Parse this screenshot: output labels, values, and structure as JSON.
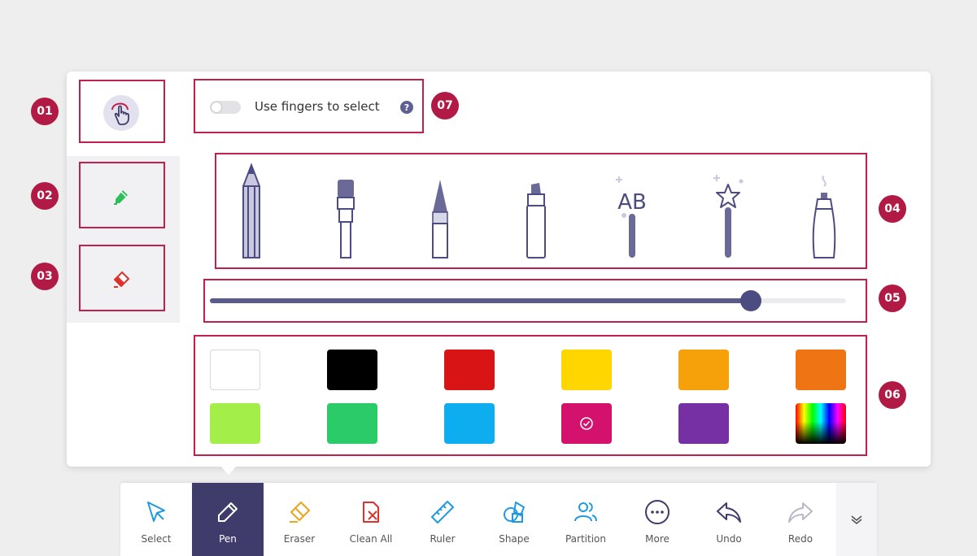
{
  "callouts": [
    "01",
    "02",
    "03",
    "04",
    "05",
    "06",
    "07"
  ],
  "finger_select": {
    "label": "Use fingers to select",
    "help_glyph": "?",
    "enabled": false
  },
  "modes": [
    {
      "icon": "finger-touch-icon",
      "selected": true
    },
    {
      "icon": "pen-mode-icon",
      "color": "#2fbf5a"
    },
    {
      "icon": "eraser-mode-icon",
      "color": "#e0302c"
    }
  ],
  "pen_types": [
    {
      "icon": "pencil-icon"
    },
    {
      "icon": "brush-icon"
    },
    {
      "icon": "fountain-tip-icon"
    },
    {
      "icon": "highlighter-icon"
    },
    {
      "icon": "text-recognition-pen-icon",
      "text": "AB"
    },
    {
      "icon": "magic-wand-icon"
    },
    {
      "icon": "spray-marker-icon"
    }
  ],
  "thickness": {
    "value_fraction": 0.85
  },
  "colors": [
    {
      "hex": "#ffffff"
    },
    {
      "hex": "#000000"
    },
    {
      "hex": "#d91414"
    },
    {
      "hex": "#ffd600"
    },
    {
      "hex": "#f6a10a"
    },
    {
      "hex": "#ee7414"
    },
    {
      "hex": "#a4ee4a"
    },
    {
      "hex": "#2ccb6a"
    },
    {
      "hex": "#0dadef"
    },
    {
      "hex": "#d4126e",
      "selected": true
    },
    {
      "hex": "#7630a3"
    },
    {
      "hex": "gradient",
      "icon": "color-spectrum-icon"
    }
  ],
  "toolbar": {
    "items": [
      {
        "label": "Select",
        "icon": "cursor-icon"
      },
      {
        "label": "Pen",
        "icon": "pen-icon",
        "active": true
      },
      {
        "label": "Eraser",
        "icon": "eraser-icon"
      },
      {
        "label": "Clean All",
        "icon": "clean-all-icon"
      },
      {
        "label": "Ruler",
        "icon": "ruler-icon"
      },
      {
        "label": "Shape",
        "icon": "shape-icon"
      },
      {
        "label": "Partition",
        "icon": "partition-icon"
      },
      {
        "label": "More",
        "icon": "more-icon"
      },
      {
        "label": "Undo",
        "icon": "undo-icon"
      },
      {
        "label": "Redo",
        "icon": "redo-icon"
      }
    ],
    "expand_icon": "chevron-down-double-icon"
  },
  "colors_accent": {
    "callout": "#c1204d",
    "badge": "#b01a45",
    "active_tool": "#3f3b6b",
    "pen_ink": "#5f5f95"
  }
}
